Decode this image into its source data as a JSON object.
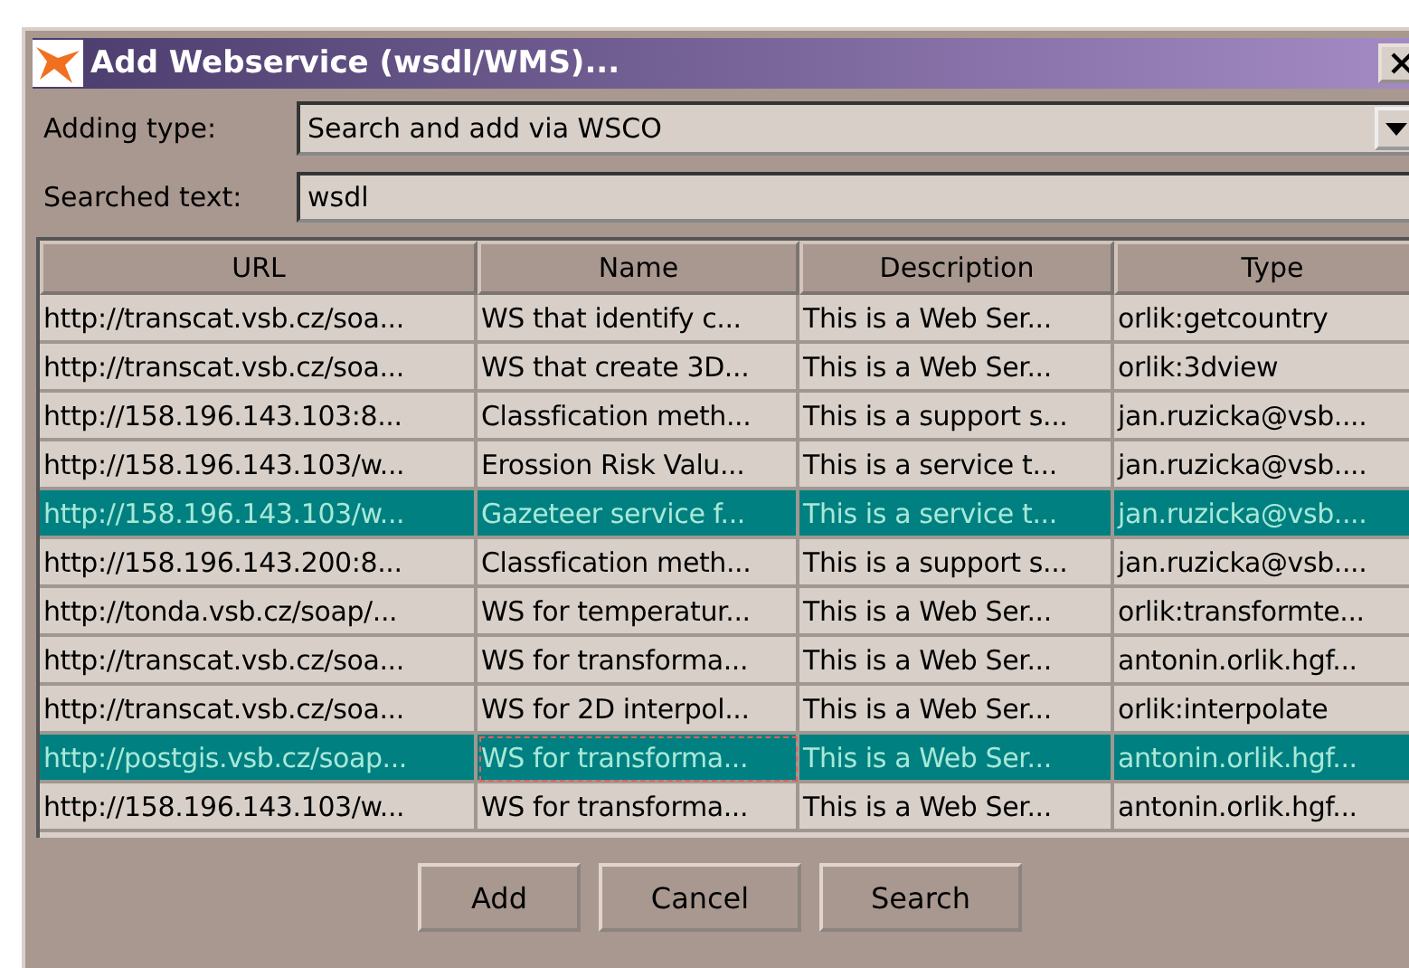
{
  "window": {
    "title": "Add Webservice (wsdl/WMS)..."
  },
  "adding_type": {
    "label": "Adding type:",
    "value": "Search and add via WSCO"
  },
  "searched_text": {
    "label": "Searched text:",
    "value": "wsdl"
  },
  "table": {
    "columns": [
      "URL",
      "Name",
      "Description",
      "Type"
    ],
    "rows": [
      {
        "selected": false,
        "focused": false,
        "cells": [
          "http://transcat.vsb.cz/soa...",
          "WS that identify c...",
          "This is a Web Ser...",
          "orlik:getcountry"
        ]
      },
      {
        "selected": false,
        "focused": false,
        "cells": [
          "http://transcat.vsb.cz/soa...",
          "WS that create 3D...",
          "This is a Web Ser...",
          "orlik:3dview"
        ]
      },
      {
        "selected": false,
        "focused": false,
        "cells": [
          "http://158.196.143.103:8...",
          "Classfication meth...",
          "This is a support s...",
          "jan.ruzicka@vsb...."
        ]
      },
      {
        "selected": false,
        "focused": false,
        "cells": [
          "http://158.196.143.103/w...",
          "Erossion Risk Valu...",
          "This is a service t...",
          "jan.ruzicka@vsb...."
        ]
      },
      {
        "selected": true,
        "focused": false,
        "cells": [
          "http://158.196.143.103/w...",
          "Gazeteer service f...",
          "This is a service t...",
          "jan.ruzicka@vsb...."
        ]
      },
      {
        "selected": false,
        "focused": false,
        "cells": [
          "http://158.196.143.200:8...",
          "Classfication meth...",
          "This is a support s...",
          "jan.ruzicka@vsb...."
        ]
      },
      {
        "selected": false,
        "focused": false,
        "cells": [
          "http://tonda.vsb.cz/soap/...",
          "WS for temperatur...",
          "This is a Web Ser...",
          "orlik:transformte..."
        ]
      },
      {
        "selected": false,
        "focused": false,
        "cells": [
          "http://transcat.vsb.cz/soa...",
          "WS for transforma...",
          "This is a Web Ser...",
          "antonin.orlik.hgf..."
        ]
      },
      {
        "selected": false,
        "focused": false,
        "cells": [
          "http://transcat.vsb.cz/soa...",
          "WS for 2D interpol...",
          "This is a Web Ser...",
          "orlik:interpolate"
        ]
      },
      {
        "selected": true,
        "focused": true,
        "cells": [
          "http://postgis.vsb.cz/soap...",
          "WS for transforma...",
          "This is a Web Ser...",
          "antonin.orlik.hgf..."
        ]
      },
      {
        "selected": false,
        "focused": false,
        "cells": [
          "http://158.196.143.103/w...",
          "WS for transforma...",
          "This is a Web Ser...",
          "antonin.orlik.hgf..."
        ]
      }
    ]
  },
  "buttons": [
    "Add",
    "Cancel",
    "Search"
  ]
}
